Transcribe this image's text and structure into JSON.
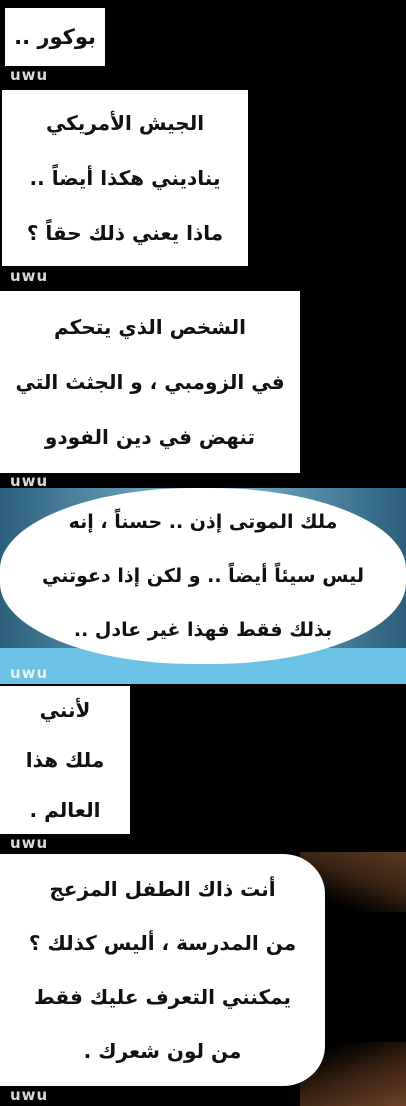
{
  "watermark": "uwu",
  "bubbles": [
    {
      "lines": [
        "بوكور .."
      ]
    },
    {
      "lines": [
        "الجيش الأمريكي",
        "يناديني هكذا أيضاً ..",
        "ماذا يعني ذلك حقاً ؟"
      ]
    },
    {
      "lines": [
        "الشخص الذي يتحكم",
        "في الزومبي ، و الجثث التي",
        "تنهض في دين الفودو"
      ]
    },
    {
      "lines": [
        "ملك الموتى إذن .. حسناً ، إنه",
        "ليس سيئاً أيضاً .. و لكن إذا دعوتني",
        "بذلك فقط فهذا غير عادل .."
      ]
    },
    {
      "lines": [
        "لأنني",
        "ملك هذا",
        "العالم ."
      ]
    },
    {
      "lines": [
        "أنت ذاك الطفل المزعج",
        "من المدرسة ، أليس كذلك ؟",
        "يمكنني التعرف عليك فقط",
        "من لون شعرك ."
      ]
    }
  ]
}
